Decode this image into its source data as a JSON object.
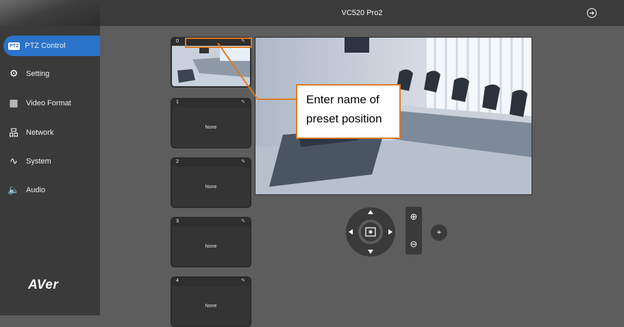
{
  "header": {
    "title": "VC520 Pro2"
  },
  "sidebar": {
    "brand": "AVer",
    "items": [
      {
        "label": "PTZ Control",
        "icon": "ptz-icon",
        "badge": "PTZ",
        "active": true
      },
      {
        "label": "Setting",
        "icon": "gear-icon"
      },
      {
        "label": "Video Format",
        "icon": "film-icon"
      },
      {
        "label": "Network",
        "icon": "network-icon"
      },
      {
        "label": "System",
        "icon": "pulse-icon"
      },
      {
        "label": "Audio",
        "icon": "speaker-icon"
      }
    ]
  },
  "presets": [
    {
      "number": "0",
      "label": ""
    },
    {
      "number": "1",
      "label": "None"
    },
    {
      "number": "2",
      "label": "None"
    },
    {
      "number": "3",
      "label": "None"
    },
    {
      "number": "4",
      "label": "None"
    }
  ],
  "annotation": {
    "text": "Enter name of preset position"
  },
  "colors": {
    "accent": "#2a73c9",
    "callout_border": "#e07a1f"
  }
}
